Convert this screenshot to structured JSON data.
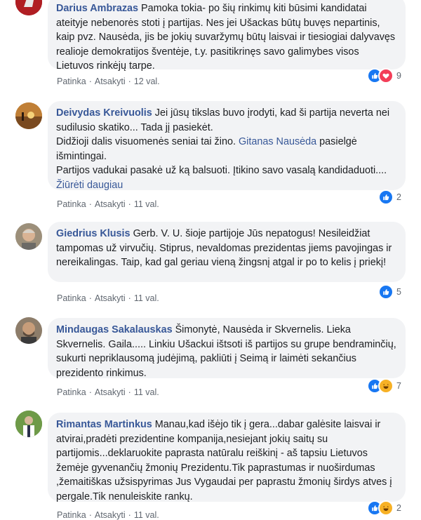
{
  "comments": [
    {
      "author": "Darius Ambrazas",
      "text": "Pamoka tokia- po šių rinkimų kiti būsimi kandidatai ateityje nebenorės stoti į partijas. Nes jei Ušackas būtų buvęs nepartinis, kaip pvz. Nausėda, jis be jokių suvaržymų būtų laisvai ir tiesiogiai dalyvavęs realioje demokratijos šventėje, t.y. pasitikrinęs savo galimybes visos Lietuvos rinkėjų tarpe.",
      "like": "Patinka",
      "reply": "Atsakyti",
      "time": "12 val.",
      "reactions": [
        "like",
        "love"
      ],
      "count": "9"
    },
    {
      "author": "Deivydas Kreivuolis",
      "text1": "Jei jūsų tikslas buvo įrodyti, kad ši partija neverta nei sudilusio skatiko... Tada jį pasiekėt.",
      "text2a": "Didžioji dalis visuomenės seniai tai žino.",
      "mention": "Gitanas Nausėda",
      "text2b": "pasielgė išmintingai.",
      "text3": "Partijos vadukai pasakė už ką balsuoti. Įtikino savo vasalą kandidaduoti....",
      "more": "Žiūrėti daugiau",
      "like": "Patinka",
      "reply": "Atsakyti",
      "time": "11 val.",
      "reactions": [
        "like"
      ],
      "count": "2"
    },
    {
      "author": "Giedrius Klusis",
      "text": "Gerb. V. U. šioje partijoje Jūs nepatogus! Nesileidžiat tampomas už virvučių. Stiprus, nevaldomas prezidentas jiems pavojingas ir nereikalingas. Taip, kad gal geriau vieną žingsnį atgal ir po to kelis į priekį!",
      "like": "Patinka",
      "reply": "Atsakyti",
      "time": "11 val.",
      "reactions": [
        "like"
      ],
      "count": "5"
    },
    {
      "author": "Mindaugas Sakalauskas",
      "text": "Šimonytė, Nausėda ir Skvernelis. Lieka Skvernelis. Gaila..... Linkiu Ušackui ištsoti iš partijos su grupe bendraminčių, sukurti nepriklausomą judėjimą, pakliūti į Seimą ir laimėti sekančius prezidento rinkimus.",
      "like": "Patinka",
      "reply": "Atsakyti",
      "time": "11 val.",
      "reactions": [
        "like",
        "haha"
      ],
      "count": "7"
    },
    {
      "author": "Rimantas Martinkus",
      "text": "Manau,kad išėjo tik į gera...dabar galėsite laisvai ir atvirai,pradėti prezidentine kompanija,nesiejant jokių saitų su partijomis...deklaruokite paprasta natūralu reiškinį - aš tapsiu Lietuvos žemėje gyvenančių žmonių Prezidentu.Tik paprastumas ir nuoširdumas ,žemaitiškas užsispyrimas Jus Vygaudai per paprastu žmonių širdys atves į pergale.Tik nenuleiskite rankų.",
      "like": "Patinka",
      "reply": "Atsakyti",
      "time": "11 val.",
      "reactions": [
        "like",
        "haha"
      ],
      "count": "2"
    }
  ],
  "colors": {
    "author": "#385898",
    "bubble": "#f2f3f5",
    "meta": "#606770",
    "like": "#1877f2",
    "love": "#f33e58",
    "haha": "#f7b125"
  }
}
